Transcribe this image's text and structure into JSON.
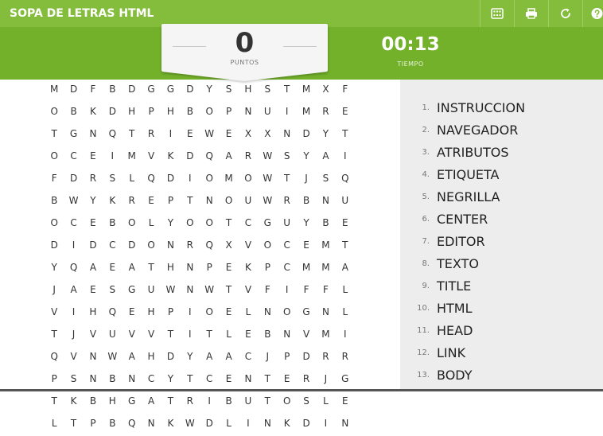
{
  "app": {
    "title": "SOPA DE LETRAS HTML"
  },
  "toolbar": [
    {
      "icon": "fullscreen-icon"
    },
    {
      "icon": "print-icon"
    },
    {
      "icon": "restart-icon"
    },
    {
      "icon": "help-icon"
    }
  ],
  "score": {
    "value": "0",
    "label": "PUNTOS"
  },
  "timer": {
    "value": "00:13",
    "label": "TIEMPO"
  },
  "colors": {
    "top_bar": "#84bd3c",
    "score_bar": "#73b12b",
    "panel": "#ededed"
  },
  "grid": [
    "MDFBDGGDYSHSTMXF",
    "OBKDHPHBOPNUIMRE",
    "TGNQTRIEWEXXNDYT",
    "OCEIMVKDQARWSYAI",
    "FDRSLQDIOMOWTJSQ",
    "BWYKREPTNOUWRBNU",
    "OCEBOLYOOTCGUYBE",
    "DIDCDONRQXVOCEMT",
    "YQAEATHNPEKPCMMA",
    "JAESGUWNWTVFIFFL",
    "VIHQEHPIOELNOGNL",
    "TJVUVVTITLEBNVMI",
    "QVNWAHDYAACJPDRR",
    "PSNBNCYTCENTERJG",
    "TKBHGATRIBUTOSLE",
    "LTPBQNKWDLINKDIN"
  ],
  "words": [
    {
      "num": "1.",
      "text": "INSTRUCCION"
    },
    {
      "num": "2.",
      "text": "NAVEGADOR"
    },
    {
      "num": "3.",
      "text": "ATRIBUTOS"
    },
    {
      "num": "4.",
      "text": "ETIQUETA"
    },
    {
      "num": "5.",
      "text": "NEGRILLA"
    },
    {
      "num": "6.",
      "text": "CENTER"
    },
    {
      "num": "7.",
      "text": "EDITOR"
    },
    {
      "num": "8.",
      "text": "TEXTO"
    },
    {
      "num": "9.",
      "text": "TITLE"
    },
    {
      "num": "10.",
      "text": "HTML"
    },
    {
      "num": "11.",
      "text": "HEAD"
    },
    {
      "num": "12.",
      "text": "LINK"
    },
    {
      "num": "13.",
      "text": "BODY"
    }
  ]
}
